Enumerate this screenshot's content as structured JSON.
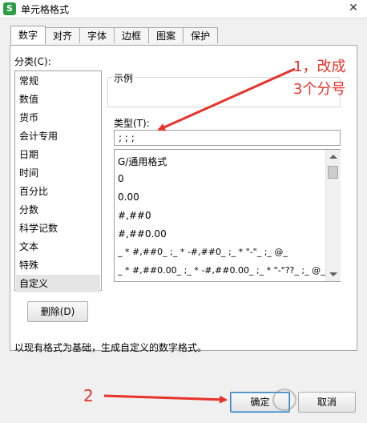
{
  "window": {
    "title": "单元格格式",
    "close_glyph": "✕",
    "app_icon_letter": "S"
  },
  "tabs": [
    "数字",
    "对齐",
    "字体",
    "边框",
    "图案",
    "保护"
  ],
  "category": {
    "label": "分类(C):",
    "items": [
      "常规",
      "数值",
      "货币",
      "会计专用",
      "日期",
      "时间",
      "百分比",
      "分数",
      "科学记数",
      "文本",
      "特殊",
      "自定义"
    ],
    "selected": "自定义"
  },
  "sample": {
    "label": "示例"
  },
  "type": {
    "label": "类型(T):",
    "value": ";  ;  ;",
    "formats": [
      "G/通用格式",
      "0",
      "0.00",
      "#,##0",
      "#,##0.00",
      "_ * #,##0_ ;_ * -#,##0_ ;_ * \"-\"_ ;_ @_",
      "_ * #,##0.00_ ;_ * -#,##0.00_ ;_ * \"-\"??_ ;_ @_"
    ]
  },
  "buttons": {
    "delete": "删除(D)",
    "ok": "确定",
    "cancel": "取消"
  },
  "description": "以现有格式为基础，生成自定义的数字格式。",
  "annotations": {
    "step1_line1": "1，改成",
    "step1_line2": "3个分号",
    "step2": "2",
    "color": "#e8322a"
  }
}
